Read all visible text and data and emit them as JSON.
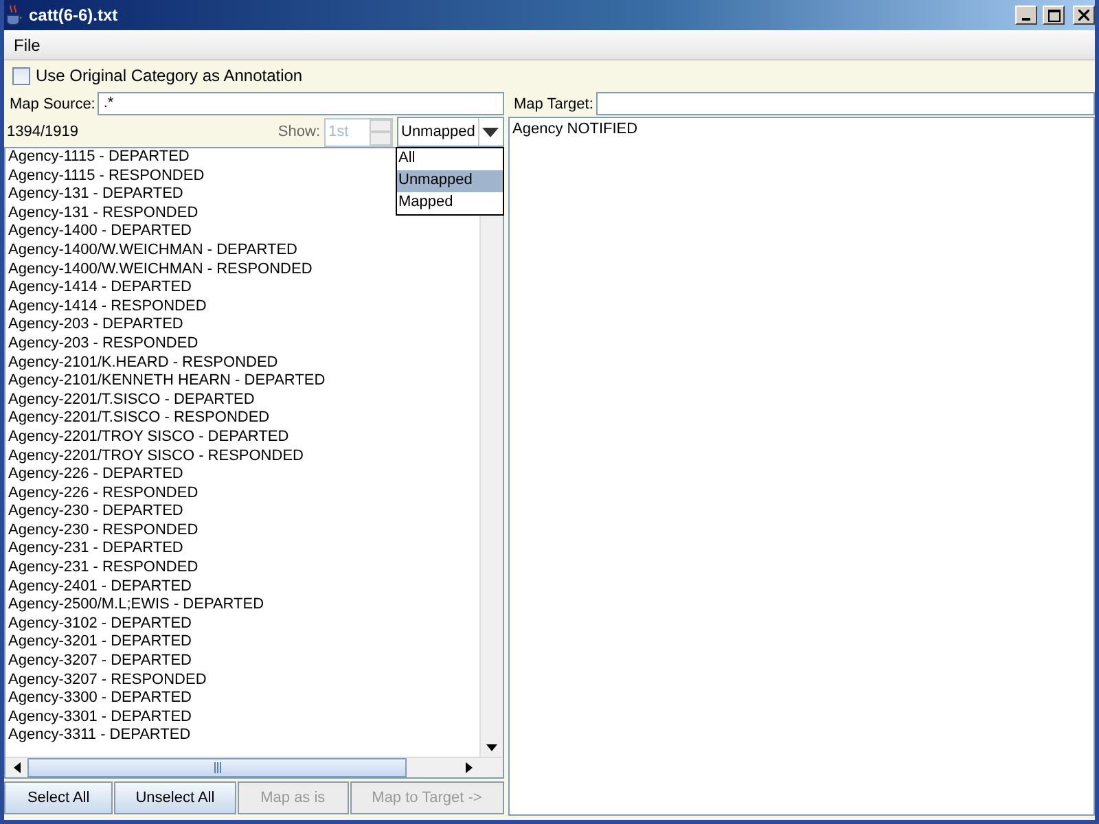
{
  "window": {
    "title": "catt(6-6).txt"
  },
  "menu": [
    "File"
  ],
  "annotation_option": {
    "label": "Use Original Category as Annotation",
    "checked": false
  },
  "source": {
    "label": "Map Source:",
    "value": ".*",
    "count": "1394/1919",
    "show_label": "Show:",
    "show_value": "1st",
    "show_disabled": true,
    "filter": {
      "value": "Unmapped",
      "expanded": true,
      "options": [
        {
          "label": "All",
          "selected": false
        },
        {
          "label": "Unmapped",
          "selected": true
        },
        {
          "label": "Mapped",
          "selected": false
        }
      ]
    }
  },
  "source_items": [
    "Agency-1115 - DEPARTED",
    "Agency-1115 - RESPONDED",
    "Agency-131 - DEPARTED",
    "Agency-131 - RESPONDED",
    "Agency-1400 - DEPARTED",
    "Agency-1400/W.WEICHMAN - DEPARTED",
    "Agency-1400/W.WEICHMAN - RESPONDED",
    "Agency-1414 - DEPARTED",
    "Agency-1414 - RESPONDED",
    "Agency-203 - DEPARTED",
    "Agency-203 - RESPONDED",
    "Agency-2101/K.HEARD - RESPONDED",
    "Agency-2101/KENNETH HEARN - DEPARTED",
    "Agency-2201/T.SISCO - DEPARTED",
    "Agency-2201/T.SISCO - RESPONDED",
    "Agency-2201/TROY SISCO - DEPARTED",
    "Agency-2201/TROY SISCO - RESPONDED",
    "Agency-226 - DEPARTED",
    "Agency-226 - RESPONDED",
    "Agency-230 - DEPARTED",
    "Agency-230 - RESPONDED",
    "Agency-231 - DEPARTED",
    "Agency-231 - RESPONDED",
    "Agency-2401 - DEPARTED",
    "Agency-2500/M.L;EWIS - DEPARTED",
    "Agency-3102 - DEPARTED",
    "Agency-3201 - DEPARTED",
    "Agency-3207 - DEPARTED",
    "Agency-3207 - RESPONDED",
    "Agency-3300 - DEPARTED",
    "Agency-3301 - DEPARTED",
    "Agency-3311 - DEPARTED"
  ],
  "buttons": [
    {
      "label": "Select All",
      "disabled": false
    },
    {
      "label": "Unselect All",
      "disabled": false
    },
    {
      "label": "Map as is",
      "disabled": true
    },
    {
      "label": "Map to Target ->",
      "disabled": true
    }
  ],
  "target": {
    "label": "Map Target:",
    "items": [
      "Agency NOTIFIED"
    ]
  }
}
